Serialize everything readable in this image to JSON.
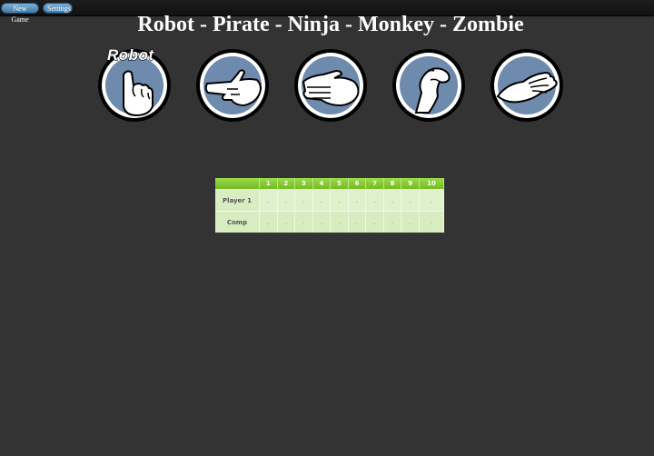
{
  "toolbar": {
    "new_game": "New Game",
    "settings": "Settings"
  },
  "title": "Robot - Pirate - Ninja - Monkey - Zombie",
  "choices": [
    {
      "id": "robot",
      "label": "Robot",
      "icon": "robot-fist-icon"
    },
    {
      "id": "pirate",
      "icon": "pirate-pointing-hand-icon"
    },
    {
      "id": "ninja",
      "icon": "ninja-flat-hand-icon"
    },
    {
      "id": "monkey",
      "icon": "monkey-hand-icon"
    },
    {
      "id": "zombie",
      "icon": "zombie-reaching-hand-icon"
    }
  ],
  "scoreboard": {
    "rounds": [
      "1",
      "2",
      "3",
      "4",
      "5",
      "6",
      "7",
      "8",
      "9",
      "10"
    ],
    "rows": [
      {
        "label": "Player 1",
        "cells": [
          ".",
          ".",
          ".",
          ".",
          ".",
          ".",
          ".",
          ".",
          ".",
          "."
        ]
      },
      {
        "label": "Comp",
        "cells": [
          ".",
          ".",
          ".",
          ".",
          ".",
          ".",
          ".",
          ".",
          ".",
          "."
        ]
      }
    ]
  },
  "colors": {
    "background": "#333333",
    "circle_fill": "#6e8aad",
    "header_green": "#86c93a",
    "cell_green": "#dff1cc"
  }
}
